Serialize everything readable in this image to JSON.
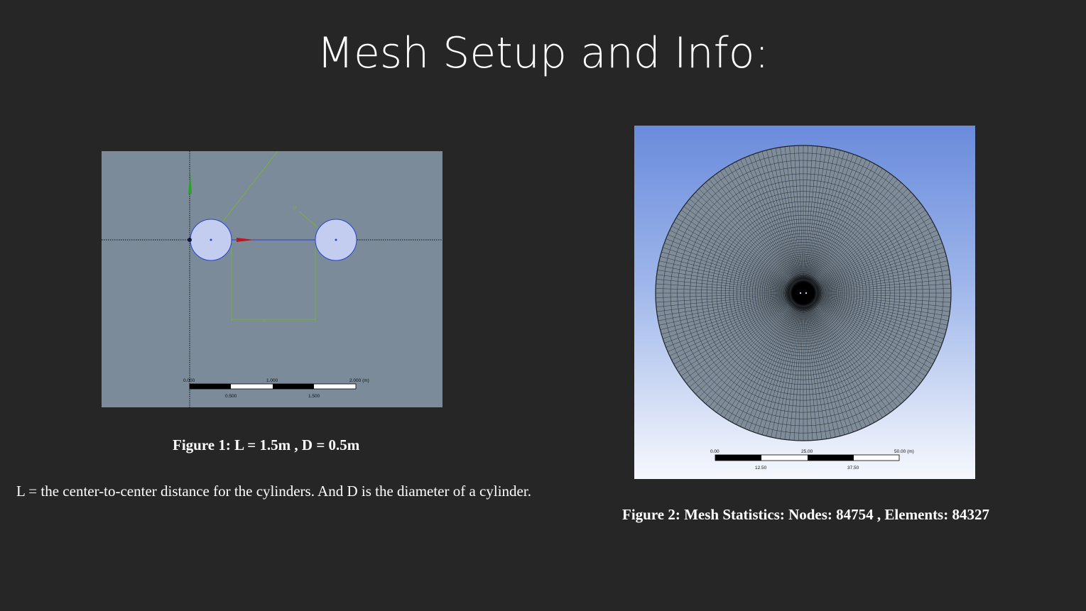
{
  "slide": {
    "title": "Mesh Setup and Info:",
    "figure1": {
      "caption": "Figure 1: L = 1.5m , D =  0.5m",
      "scale_top": [
        "0.000",
        "1.000",
        "2.000 (m)"
      ],
      "scale_bottom": [
        "0.500",
        "1.500"
      ]
    },
    "figure2": {
      "caption": "Figure 2: Mesh Statistics: Nodes: 84754 , Elements: 84327",
      "scale_top": [
        "0.00",
        "25.00",
        "50.00 (m)"
      ],
      "scale_bottom": [
        "12.50",
        "37.50"
      ]
    },
    "description": "L = the center-to-center distance for the cylinders. And D is the diameter of a cylinder."
  },
  "colors": {
    "background": "#262626",
    "sketch_bg": "#7b8b9a",
    "cylinder_fill": "#c3cdf0",
    "cylinder_stroke": "#2b3fd1",
    "mesh_fill": "#7f8c99",
    "mesh_line": "#1d2226",
    "dimension_green": "#7ab03c"
  },
  "icons": [
    "axis-triad-icon"
  ]
}
